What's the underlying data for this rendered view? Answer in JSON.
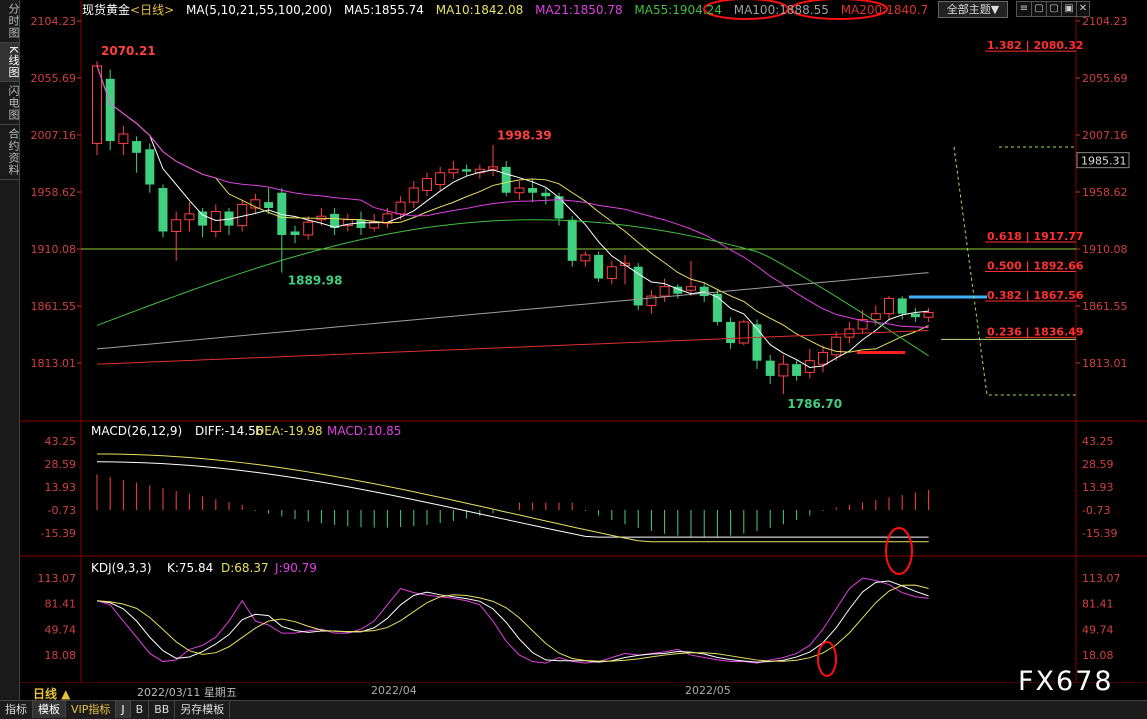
{
  "sidebar": {
    "tabs": [
      {
        "label": "分时图",
        "active": false
      },
      {
        "label": "K线图",
        "active": true
      },
      {
        "label": "闪电图",
        "active": false
      },
      {
        "label": "合约资料",
        "active": false
      }
    ]
  },
  "header": {
    "instrument": "现货黄金",
    "period_tag": "<日线>",
    "ma_params": "MA(5,10,21,55,100,200)",
    "ma5": "MA5:1855.74",
    "ma10": "MA10:1842.08",
    "ma21": "MA21:1850.78",
    "ma55": "MA55:1904.24",
    "ma100": "MA100:1888.55",
    "ma200": "MA200:1840.7",
    "theme_button": "全部主题▼"
  },
  "window_buttons": [
    "≡",
    "▢",
    "▢",
    "▣",
    "✕"
  ],
  "colors": {
    "up": "#ff4040",
    "down": "#40d080",
    "ma5": "#ffffff",
    "ma10": "#e8e060",
    "ma21": "#e040e0",
    "ma55": "#40c040",
    "ma100": "#a0a0a0",
    "ma200": "#e03030",
    "fib": "#ff3030",
    "accent": "#e8c040"
  },
  "price_axis": {
    "left_ticks": [
      "2104.23",
      "2055.69",
      "2007.16",
      "1958.62",
      "1910.08",
      "1861.55",
      "1813.01"
    ],
    "right_ticks": [
      "2104.23",
      "2055.69",
      "2007.16",
      "1958.62",
      "1910.08",
      "1861.55",
      "1813.01"
    ],
    "current_price": "1985.31"
  },
  "annotations": {
    "high": "2070.21",
    "mid_high": "1998.39",
    "low1": "1889.98",
    "low2": "1786.70"
  },
  "fib_levels": [
    {
      "label": "1.382 | 2080.32",
      "price": 2080.32
    },
    {
      "label": "0.618 | 1917.77",
      "price": 1917.77
    },
    {
      "label": "0.500 | 1892.66",
      "price": 1892.66
    },
    {
      "label": "0.382 | 1867.56",
      "price": 1867.56
    },
    {
      "label": "0.236 | 1836.49",
      "price": 1836.49
    }
  ],
  "macd_panel": {
    "title": "MACD(26,12,9)",
    "diff": "DIFF:-14.56",
    "dea": "DEA:-19.98",
    "macd": "MACD:10.85",
    "ticks": [
      "43.25",
      "28.59",
      "13.93",
      "-0.73",
      "-15.39"
    ]
  },
  "kdj_panel": {
    "title": "KDJ(9,3,3)",
    "k": "K:75.84",
    "d": "D:68.37",
    "j": "J:90.79",
    "ticks": [
      "113.07",
      "81.41",
      "49.74",
      "18.08"
    ]
  },
  "date_axis": {
    "period": "日线 ▲",
    "cursor_date": "2022/03/11 星期五",
    "labels": [
      "2022/04",
      "2022/05"
    ]
  },
  "bottom_tabs": [
    {
      "label": "指标",
      "active": false
    },
    {
      "label": "模板",
      "active": true
    },
    {
      "label": "VIP指标",
      "active": false
    },
    {
      "label": "J",
      "active": true
    },
    {
      "label": "B",
      "active": false
    },
    {
      "label": "BB",
      "active": false
    },
    {
      "label": "另存模板",
      "active": false
    }
  ],
  "watermark": "FX678"
}
